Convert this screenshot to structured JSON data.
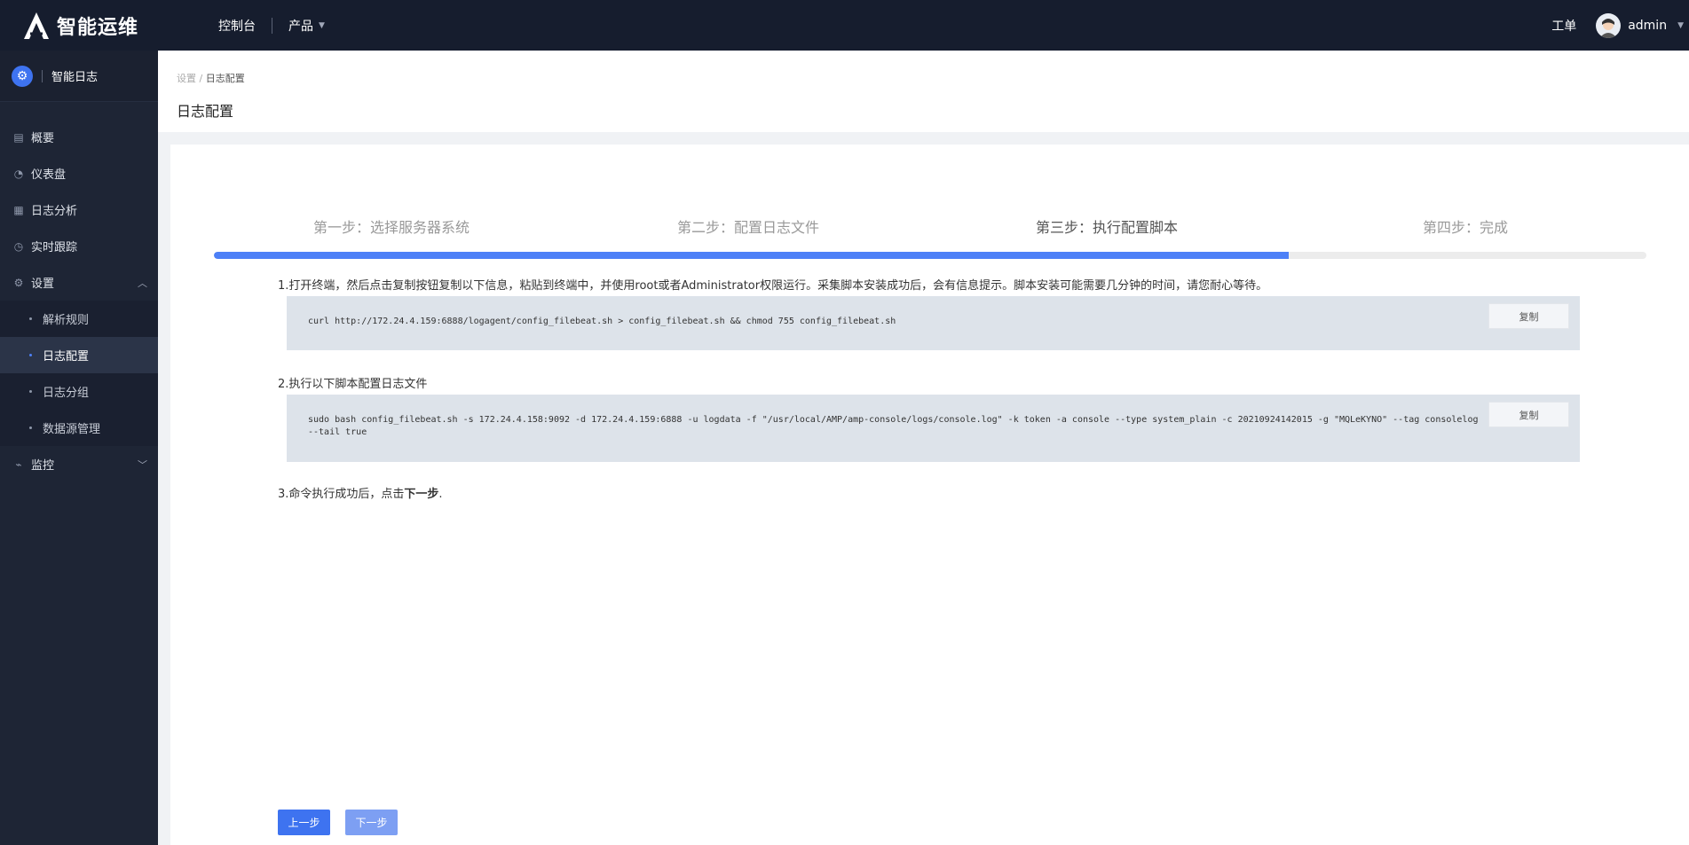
{
  "topbar": {
    "logo_text": "智能运维",
    "nav": [
      {
        "label": "控制台"
      },
      {
        "label": "产品"
      }
    ],
    "ticket": "工单",
    "user": "admin"
  },
  "sidebar": {
    "app_name": "智能日志",
    "items": [
      {
        "label": "概要",
        "icon": "document-icon"
      },
      {
        "label": "仪表盘",
        "icon": "dashboard-icon"
      },
      {
        "label": "日志分析",
        "icon": "log-analysis-icon"
      },
      {
        "label": "实时跟踪",
        "icon": "clock-icon"
      },
      {
        "label": "设置",
        "icon": "gear-icon"
      }
    ],
    "settings_sub": [
      {
        "label": "解析规则"
      },
      {
        "label": "日志配置"
      },
      {
        "label": "日志分组"
      },
      {
        "label": "数据源管理"
      }
    ],
    "monitor": {
      "label": "监控",
      "icon": "monitor-icon"
    }
  },
  "header": {
    "breadcrumb_root": "设置",
    "breadcrumb_sep": "/",
    "breadcrumb_current": "日志配置",
    "title": "日志配置"
  },
  "wizard": {
    "steps": [
      {
        "label": "第一步：选择服务器系统"
      },
      {
        "label": "第二步：配置日志文件"
      },
      {
        "label": "第三步：执行配置脚本"
      },
      {
        "label": "第四步：完成"
      }
    ],
    "progress_percent": 75,
    "instruction1": "1.打开终端，然后点击复制按钮复制以下信息，粘贴到终端中，并使用root或者Administrator权限运行。采集脚本安装成功后，会有信息提示。脚本安装可能需要几分钟的时间，请您耐心等待。",
    "code1": "curl http://172.24.4.159:6888/logagent/config_filebeat.sh > config_filebeat.sh && chmod 755 config_filebeat.sh",
    "instruction2": "2.执行以下脚本配置日志文件",
    "code2": "sudo bash config_filebeat.sh -s 172.24.4.158:9092 -d 172.24.4.159:6888 -u logdata -f \"/usr/local/AMP/amp-console/logs/console.log\" -k token -a console --type system_plain -c 20210924142015 -g \"MQLeKYNO\" --tag consolelog --tail true",
    "copy_label": "复制",
    "instruction3_prefix": "3.命令执行成功后，点击",
    "instruction3_bold": "下一步",
    "instruction3_suffix": ".",
    "prev_label": "上一步",
    "next_label": "下一步"
  }
}
